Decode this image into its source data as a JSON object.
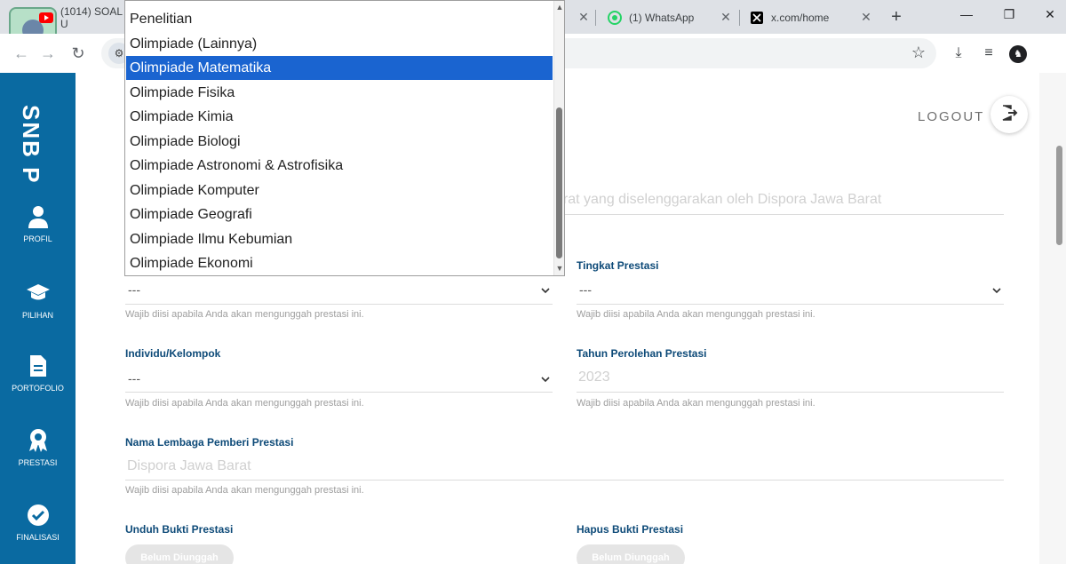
{
  "browser": {
    "tabs": [
      {
        "title": "(1014) SOAL U",
        "icon": "youtube-icon"
      },
      {
        "title": "(1) WhatsApp",
        "icon": "whatsapp-icon"
      },
      {
        "title": "x.com/home",
        "icon": "x-icon"
      }
    ],
    "new_tab": "+",
    "controls": {
      "minimize": "—",
      "restore": "❐",
      "close": "✕"
    },
    "accent": "#1a64d0"
  },
  "sidebar": {
    "brand": "SNB P",
    "color": "#0a6aa1",
    "items": [
      {
        "label": "PROFIL",
        "icon": "person-icon"
      },
      {
        "label": "PILIHAN",
        "icon": "graduation-cap-icon"
      },
      {
        "label": "PORTOFOLIO",
        "icon": "document-icon"
      },
      {
        "label": "PRESTASI",
        "icon": "award-icon"
      },
      {
        "label": "FINALISASI",
        "icon": "check-circle-icon"
      }
    ]
  },
  "header": {
    "logout_label": "LOGOUT"
  },
  "form": {
    "event_name_value": "arat yang diselenggarakan oleh Dispora Jawa Barat",
    "tingkat_label": "Tingkat Prestasi",
    "tingkat_value": "---",
    "jenis_value": "---",
    "individu_label": "Individu/Kelompok",
    "individu_value": "---",
    "tahun_label": "Tahun Perolehan Prestasi",
    "tahun_value": "2023",
    "lembaga_label": "Nama Lembaga Pemberi Prestasi",
    "lembaga_value": "Dispora Jawa Barat",
    "hint": "Wajib diisi apabila Anda akan mengunggah prestasi ini.",
    "unduh_label": "Unduh Bukti Prestasi",
    "hapus_label": "Hapus Bukti Prestasi",
    "unduh_button": "Belum Diunggah",
    "hapus_button": "Belum Diunggah"
  },
  "dropdown": {
    "options": [
      "Penelitian",
      "Olimpiade (Lainnya)",
      "Olimpiade Matematika",
      "Olimpiade Fisika",
      "Olimpiade Kimia",
      "Olimpiade Biologi",
      "Olimpiade Astronomi & Astrofisika",
      "Olimpiade Komputer",
      "Olimpiade Geografi",
      "Olimpiade Ilmu Kebumian",
      "Olimpiade Ekonomi"
    ],
    "selected": "Olimpiade Matematika"
  }
}
